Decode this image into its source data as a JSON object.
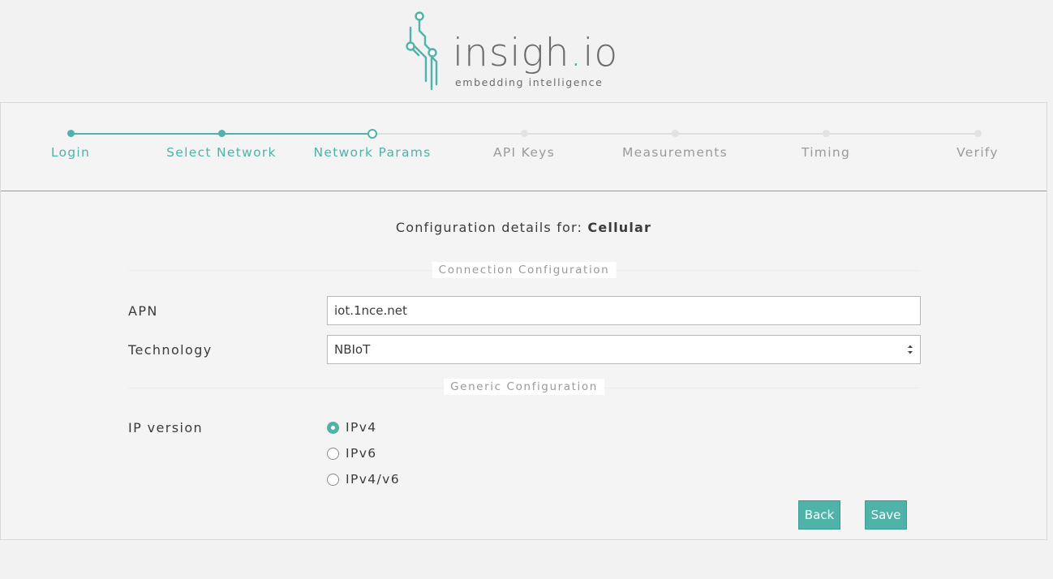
{
  "brand": {
    "wordmark_main": "insigh",
    "wordmark_dot": ".",
    "wordmark_end": "io",
    "tagline": "embedding intelligence",
    "accent_color": "#4fb3a9"
  },
  "stepper": {
    "steps": [
      {
        "label": "Login",
        "state": "done"
      },
      {
        "label": "Select Network",
        "state": "done"
      },
      {
        "label": "Network Params",
        "state": "active"
      },
      {
        "label": "API Keys",
        "state": "todo"
      },
      {
        "label": "Measurements",
        "state": "todo"
      },
      {
        "label": "Timing",
        "state": "todo"
      },
      {
        "label": "Verify",
        "state": "todo"
      }
    ]
  },
  "config": {
    "title_prefix": "Configuration details for:",
    "title_value": "Cellular"
  },
  "connection_section": {
    "title": "Connection Configuration",
    "apn_label": "APN",
    "apn_value": "iot.1nce.net",
    "technology_label": "Technology",
    "technology_value": "NBIoT"
  },
  "generic_section": {
    "title": "Generic Configuration",
    "ip_version_label": "IP version",
    "options": [
      {
        "label": "IPv4",
        "checked": true
      },
      {
        "label": "IPv6",
        "checked": false
      },
      {
        "label": "IPv4/v6",
        "checked": false
      }
    ]
  },
  "actions": {
    "back_label": "Back",
    "save_label": "Save"
  }
}
